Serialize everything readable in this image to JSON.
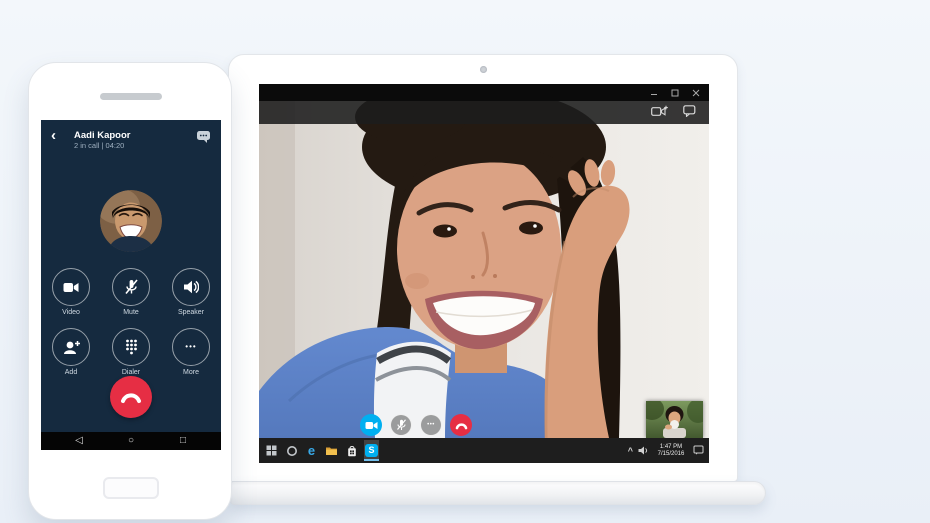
{
  "colors": {
    "page-bg-top": "#f3f7fb",
    "page-bg-bottom": "#e9eff7",
    "skype-blue": "#00aff0",
    "end-call-red": "#e62e44",
    "phone-navy": "#152a3f",
    "titlebar-black": "#0b0b0b",
    "taskbar-dark": "#1e1e1e"
  },
  "phone": {
    "header": {
      "back_glyph": "‹",
      "contact_name": "Aadi Kapoor",
      "call_status": "2 in call | 04:20"
    },
    "controls": [
      {
        "id": "video",
        "label": "Video"
      },
      {
        "id": "mute",
        "label": "Mute"
      },
      {
        "id": "speaker",
        "label": "Speaker"
      },
      {
        "id": "add",
        "label": "Add"
      },
      {
        "id": "dialer",
        "label": "Dialer"
      },
      {
        "id": "more",
        "label": "More"
      }
    ],
    "more_glyph": "•••",
    "android_nav": {
      "back": "◁",
      "home": "○",
      "recents": "□"
    }
  },
  "laptop": {
    "call_controls": {
      "more_glyph": "•••"
    },
    "taskbar": {
      "edge_letter": "e",
      "skype_letter": "S",
      "tray_caret": "^",
      "clock": {
        "time": "1:47 PM",
        "date": "7/15/2016"
      }
    }
  }
}
